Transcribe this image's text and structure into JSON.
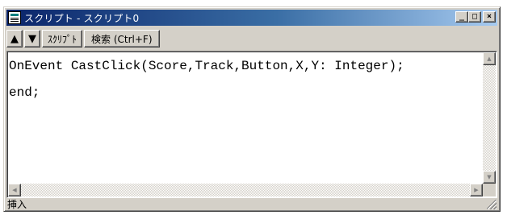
{
  "window": {
    "title": "スクリプト - スクリプト0",
    "app_icon": "script-window-icon",
    "controls": {
      "minimize": "_",
      "maximize": "□",
      "close": "×"
    }
  },
  "toolbar": {
    "up_arrow": "▲",
    "down_arrow": "▼",
    "script_label": "ｽｸﾘﾌﾟﾄ",
    "search_label": "検索 (Ctrl+F)"
  },
  "editor": {
    "lines": [
      "OnEvent CastClick(Score,Track,Button,X,Y: Integer);",
      "end;"
    ]
  },
  "scrollbars": {
    "up": "▲",
    "down": "▼",
    "left": "◀",
    "right": "▶"
  },
  "status": {
    "mode": "挿入"
  }
}
